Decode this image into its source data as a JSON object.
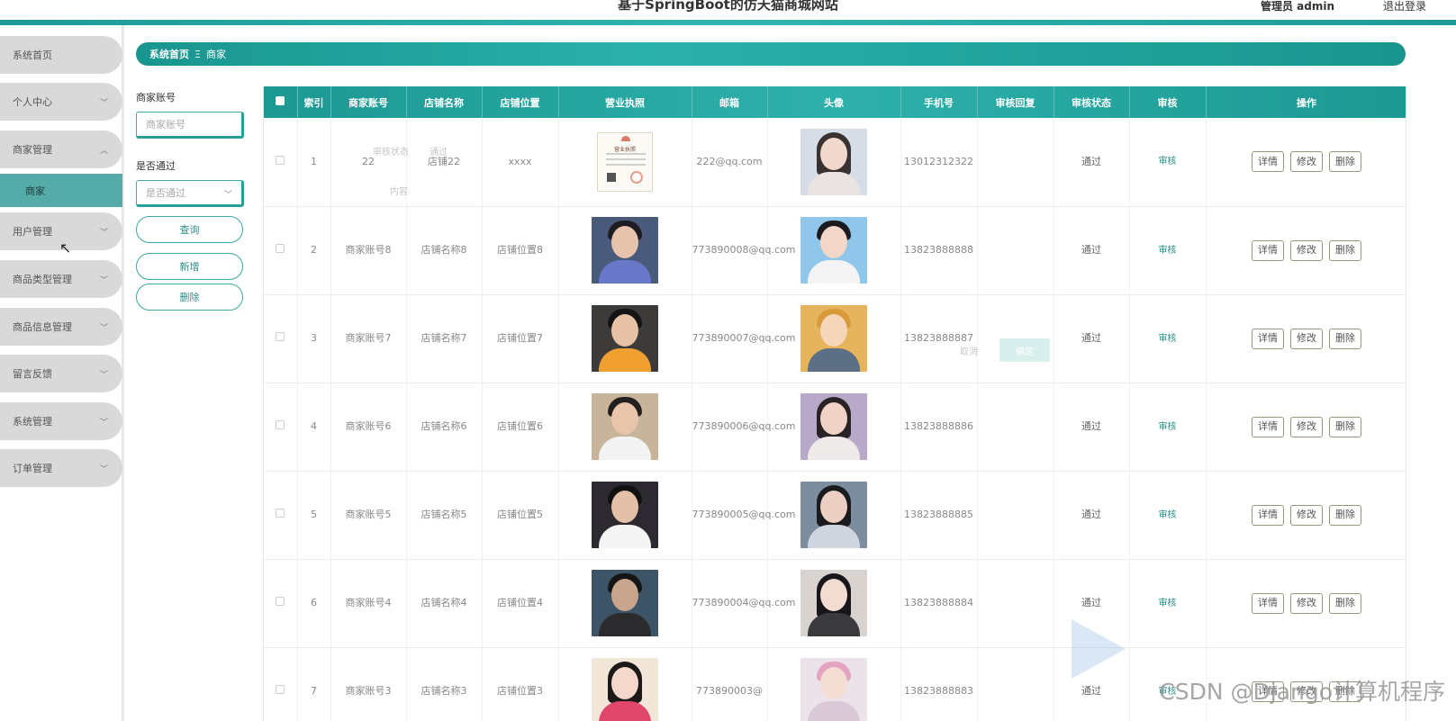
{
  "header": {
    "title": "基于SpringBoot的仿天猫商城网站",
    "admin_label": "管理员 admin",
    "logout_label": "退出登录"
  },
  "sidebar": {
    "items": [
      {
        "label": "系统首页",
        "chevron": false
      },
      {
        "label": "个人中心",
        "chevron": true
      },
      {
        "label": "商家管理",
        "chevron": true,
        "expanded": true
      },
      {
        "label": "用户管理",
        "chevron": true
      },
      {
        "label": "商品类型管理",
        "chevron": true
      },
      {
        "label": "商品信息管理",
        "chevron": true
      },
      {
        "label": "留言反馈",
        "chevron": true
      },
      {
        "label": "系统管理",
        "chevron": true
      },
      {
        "label": "订单管理",
        "chevron": true
      }
    ],
    "active_sub": "商家"
  },
  "breadcrumb": {
    "home": "系统首页",
    "separator": "Ξ",
    "current": "商家"
  },
  "filter": {
    "account_label": "商家账号",
    "account_placeholder": "商家账号",
    "pass_label": "是否通过",
    "pass_placeholder": "是否通过",
    "query_button": "查询",
    "add_button": "新增",
    "delete_button": "删除"
  },
  "table": {
    "columns": [
      "索引",
      "商家账号",
      "店铺名称",
      "店铺位置",
      "营业执照",
      "邮箱",
      "头像",
      "手机号",
      "审核回复",
      "审核状态",
      "审核",
      "操作"
    ],
    "op_labels": {
      "detail": "详情",
      "edit": "修改",
      "delete": "删除"
    },
    "audit_label": "审核",
    "rows": [
      {
        "index": "1",
        "account": "22",
        "shop": "店铺22",
        "location": "xxxx",
        "email": "222@qq.com",
        "phone": "13012312322",
        "reply": "",
        "status": "通过",
        "license_text": "营业执照"
      },
      {
        "index": "2",
        "account": "商家账号8",
        "shop": "店铺名称8",
        "location": "店铺位置8",
        "email": "773890008@qq.com",
        "phone": "13823888888",
        "reply": "",
        "status": "通过"
      },
      {
        "index": "3",
        "account": "商家账号7",
        "shop": "店铺名称7",
        "location": "店铺位置7",
        "email": "773890007@qq.com",
        "phone": "13823888887",
        "reply": "",
        "status": "通过"
      },
      {
        "index": "4",
        "account": "商家账号6",
        "shop": "店铺名称6",
        "location": "店铺位置6",
        "email": "773890006@qq.com",
        "phone": "13823888886",
        "reply": "",
        "status": "通过"
      },
      {
        "index": "5",
        "account": "商家账号5",
        "shop": "店铺名称5",
        "location": "店铺位置5",
        "email": "773890005@qq.com",
        "phone": "13823888885",
        "reply": "",
        "status": "通过"
      },
      {
        "index": "6",
        "account": "商家账号4",
        "shop": "店铺名称4",
        "location": "店铺位置4",
        "email": "773890004@qq.com",
        "phone": "13823888884",
        "reply": "",
        "status": "通过"
      },
      {
        "index": "7",
        "account": "商家账号3",
        "shop": "店铺名称3",
        "location": "店铺位置3",
        "email": "773890003@",
        "phone": "13823888883",
        "reply": "",
        "status": "通过"
      }
    ]
  },
  "overlay": {
    "ghost_status_label": "审核状态",
    "ghost_status_value": "通过",
    "ghost_content_label": "内容",
    "ghost_cancel": "取消",
    "ghost_confirm": "确定"
  },
  "watermark": "CSDN @Django计算机程序",
  "colors": {
    "accent": "#1e9a97",
    "sidebar_item": "#d9d9d9",
    "sidebar_active": "#55aba8"
  }
}
